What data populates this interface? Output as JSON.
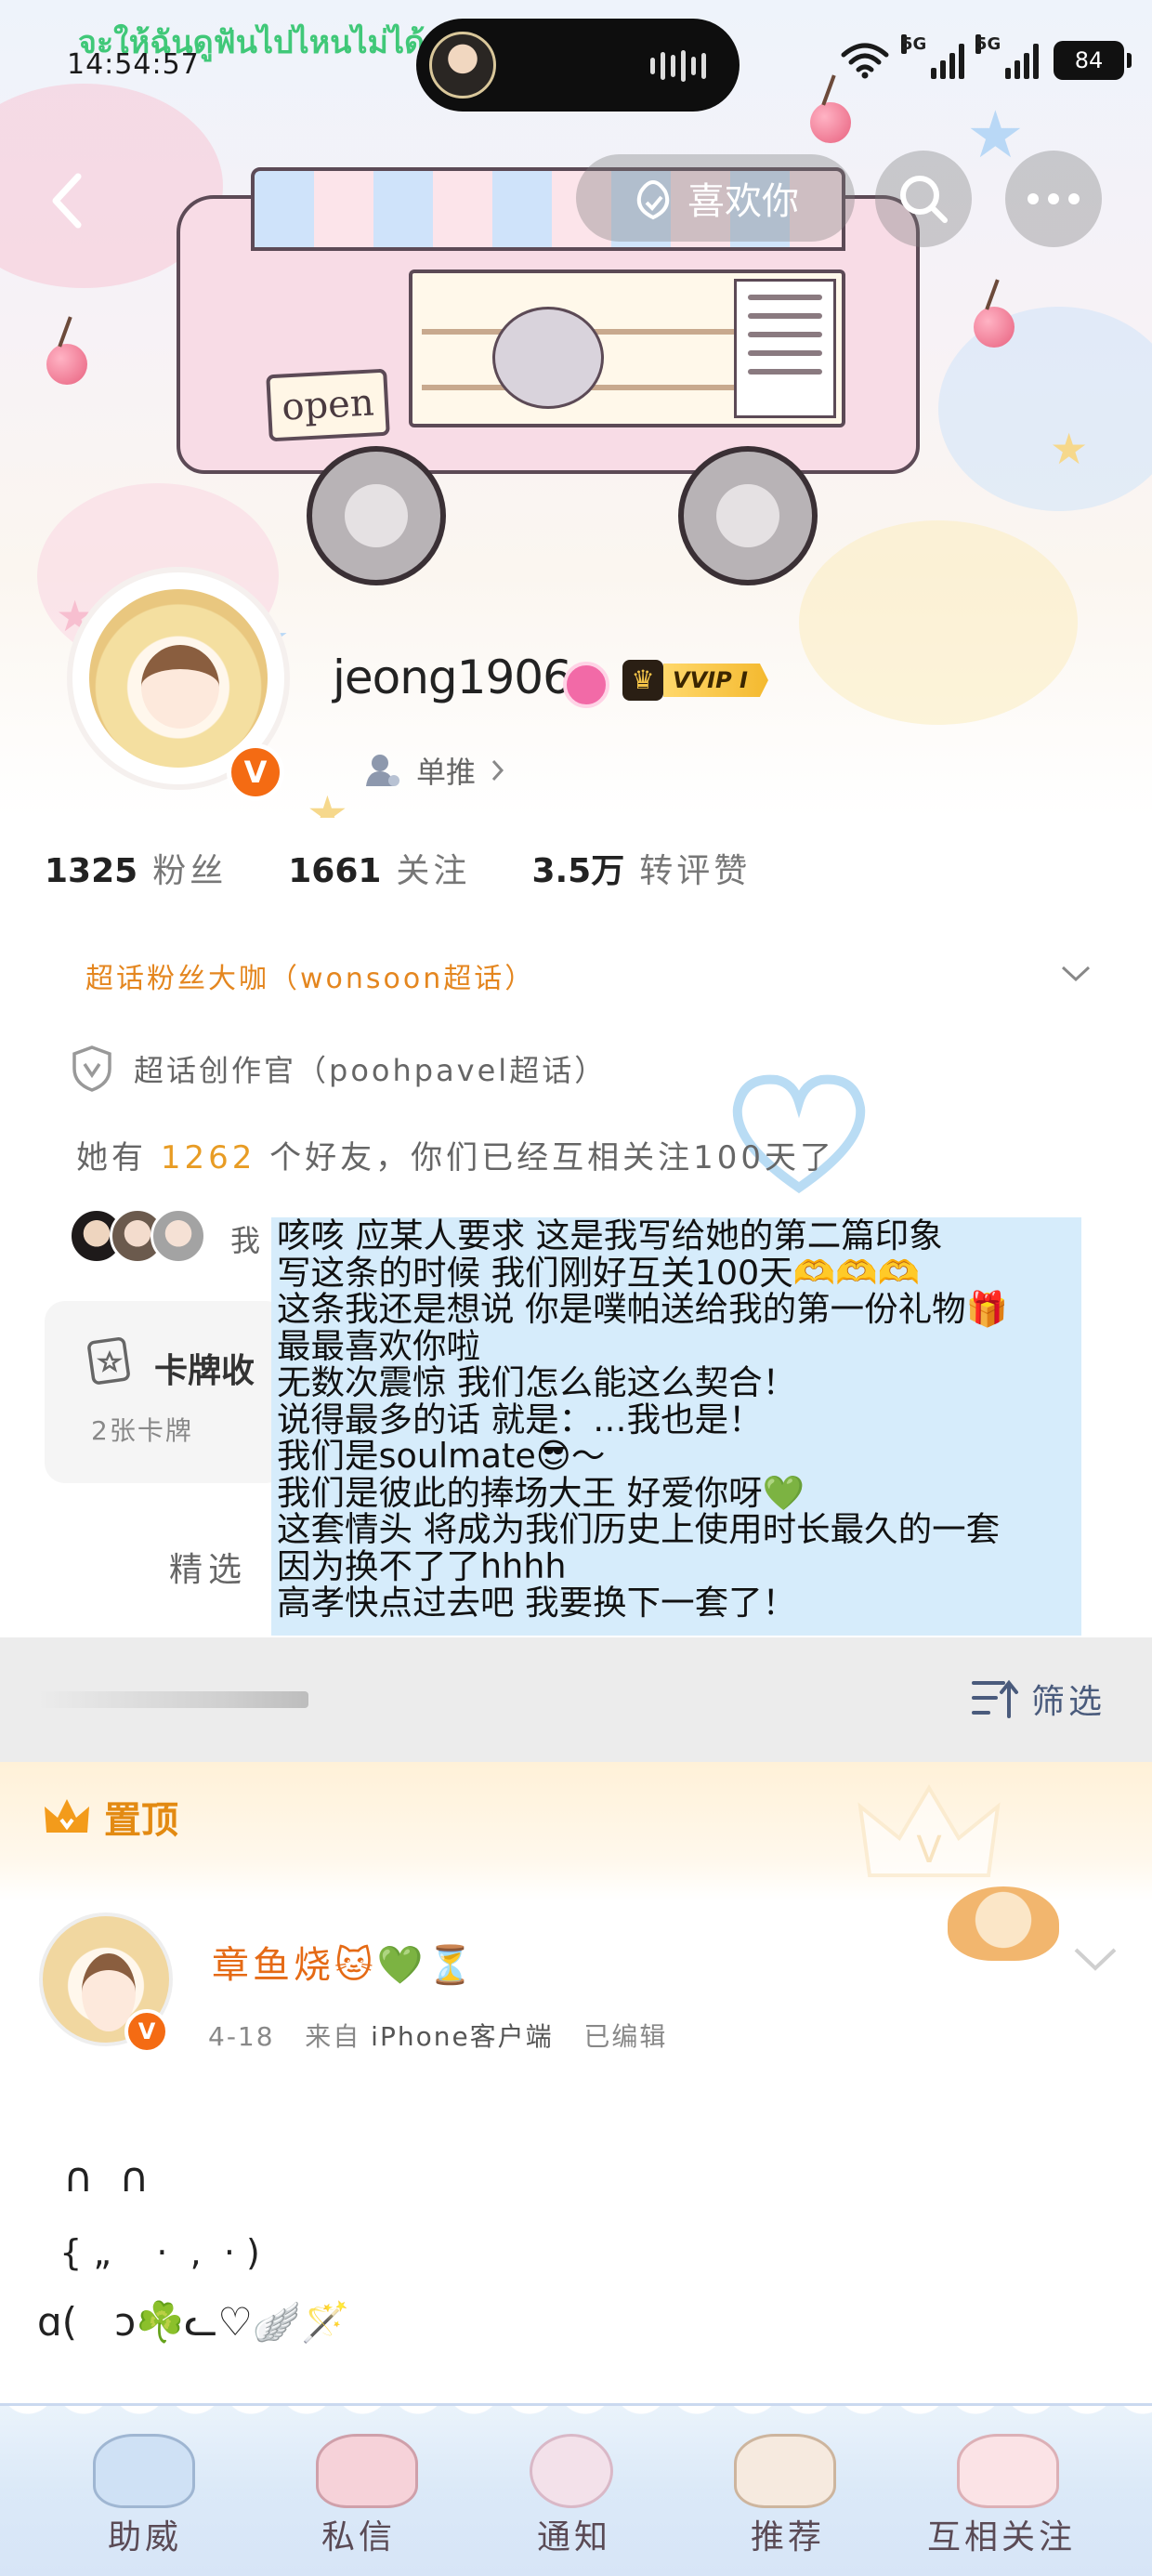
{
  "status_bar": {
    "time": "14:54:57",
    "overlay_text": "จะให้ฉันดูฟันไปไหนไม่ได้",
    "network_1": "5G",
    "network_2": "5G",
    "battery": "84"
  },
  "nav": {
    "like_label": "喜欢你"
  },
  "banner": {
    "sign_text": "open"
  },
  "profile": {
    "username": "jeong1906",
    "verified_mark": "V",
    "vip_label": "VVIP I",
    "single_push_label": "单推",
    "stats": [
      {
        "value": "1325",
        "label": "粉丝"
      },
      {
        "value": "1661",
        "label": "关注"
      },
      {
        "value": "3.5万",
        "label": "转评赞"
      }
    ],
    "superfan_text": "超话粉丝大咖（wonsoon超话）",
    "creator_text": "超话创作官（poohpavel超话）",
    "friends_prefix": "她有",
    "friends_count": "1262",
    "friends_suffix": "个好友，你们已经互相关注100天了",
    "mutual_label": "我",
    "card_title": "卡牌收",
    "card_sub": "2张卡牌",
    "featured_label": "精选"
  },
  "note_lines": [
    "咳咳 应某人要求 这是我写给她的第二篇印象",
    "写这条的时候 我们刚好互关100天🫶🫶🫶",
    "这条我还是想说 你是噗帕送给我的第一份礼物🎁",
    "最最喜欢你啦",
    "无数次震惊 我们怎么能这么契合！",
    "说得最多的话 就是：…我也是！",
    "我们是soulmate😎～",
    "我们是彼此的捧场大王 好爱你呀💚",
    "这套情头 将成为我们历史上使用时长最久的一套",
    "因为换不了了hhhh",
    "高孝快点过去吧 我要换下一套了！"
  ],
  "filter": {
    "label": "筛选"
  },
  "pinned": {
    "label": "置顶",
    "post": {
      "author": "章鱼烧🐱💚⏳",
      "verified_mark": "V",
      "date": "4-18",
      "source_prefix": "来自",
      "source": "iPhone客户端",
      "edited": "已编辑",
      "art_line_1": "  ∩  ∩",
      "art_line_2": "  { „    ·  ,  · )",
      "art_line_3": "ɑ(   ɔ☘️ᓚ♡🪽🪄"
    }
  },
  "bottom_tabs": [
    "助威",
    "私信",
    "通知",
    "推荐",
    "互相关注"
  ],
  "colors": {
    "accent_orange": "#e4861f",
    "vip_gold": "#f4b92f",
    "note_bg": "#d6ecfb",
    "author_orange": "#e56a15",
    "filter_blue": "#4a5b7c"
  }
}
